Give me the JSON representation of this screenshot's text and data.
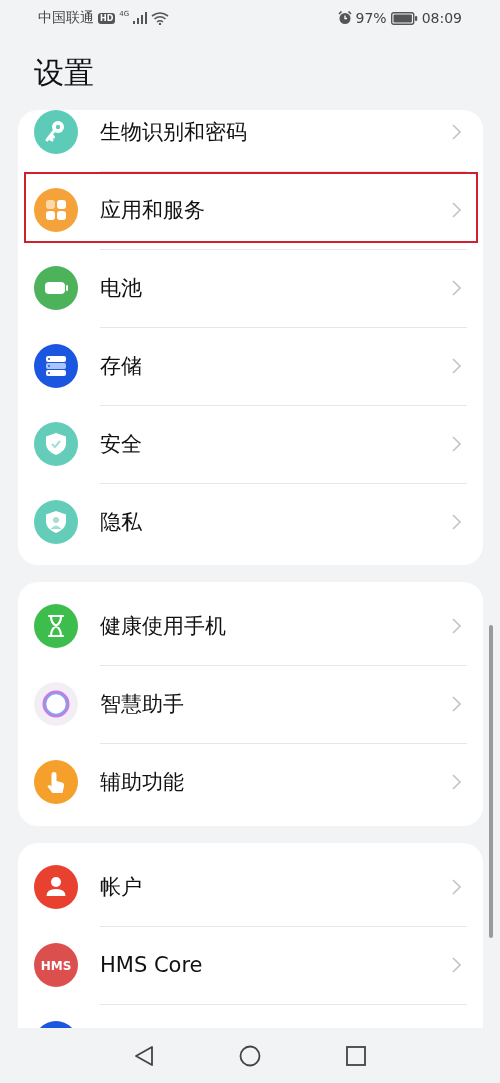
{
  "status_bar": {
    "carrier": "中国联通",
    "hd_badge": "HD",
    "network": "4G",
    "battery_percent": "97%",
    "time": "08:09"
  },
  "title": "设置",
  "groups": [
    {
      "items": [
        {
          "kind": "setting",
          "label": "生物识别和密码",
          "highlighted": false
        },
        {
          "kind": "setting",
          "label": "应用和服务",
          "highlighted": true
        },
        {
          "kind": "setting",
          "label": "电池",
          "highlighted": false
        },
        {
          "kind": "setting",
          "label": "存储",
          "highlighted": false
        },
        {
          "kind": "setting",
          "label": "安全",
          "highlighted": false
        },
        {
          "kind": "setting",
          "label": "隐私",
          "highlighted": false
        }
      ]
    },
    {
      "items": [
        {
          "kind": "setting",
          "label": "健康使用手机",
          "highlighted": false
        },
        {
          "kind": "setting",
          "label": "智慧助手",
          "highlighted": false
        },
        {
          "kind": "setting",
          "label": "辅助功能",
          "highlighted": false
        }
      ]
    },
    {
      "items": [
        {
          "kind": "setting",
          "label": "帐户",
          "highlighted": false
        },
        {
          "kind": "setting",
          "icon_text": "HMS",
          "label": "HMS Core",
          "highlighted": false
        },
        {
          "kind": "partial"
        }
      ]
    }
  ]
}
